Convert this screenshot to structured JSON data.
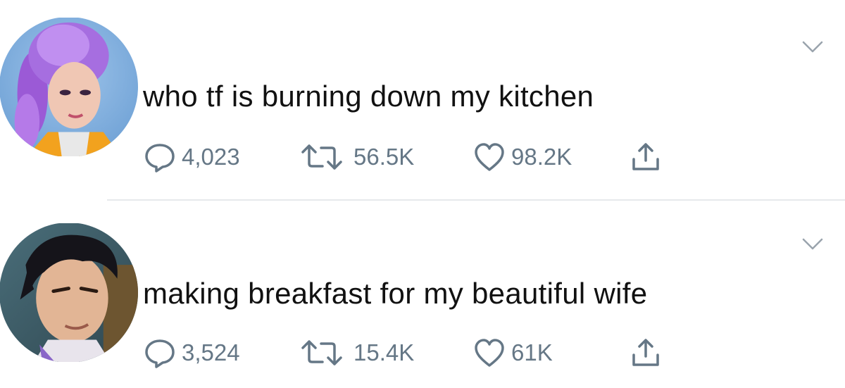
{
  "tweets": [
    {
      "avatar": "purple-braided-hair-character-avatar",
      "text": "who tf is burning down my kitchen",
      "replies": "4,023",
      "retweets": "56.5K",
      "likes": "98.2K"
    },
    {
      "avatar": "dark-haired-man-character-avatar",
      "text": "making breakfast for my beautiful wife",
      "replies": "3,524",
      "retweets": "15.4K",
      "likes": "61K"
    }
  ],
  "colors": {
    "icon_gray": "#657786",
    "text": "#14171a",
    "divider": "#e6e9ec",
    "background": "#ffffff"
  }
}
